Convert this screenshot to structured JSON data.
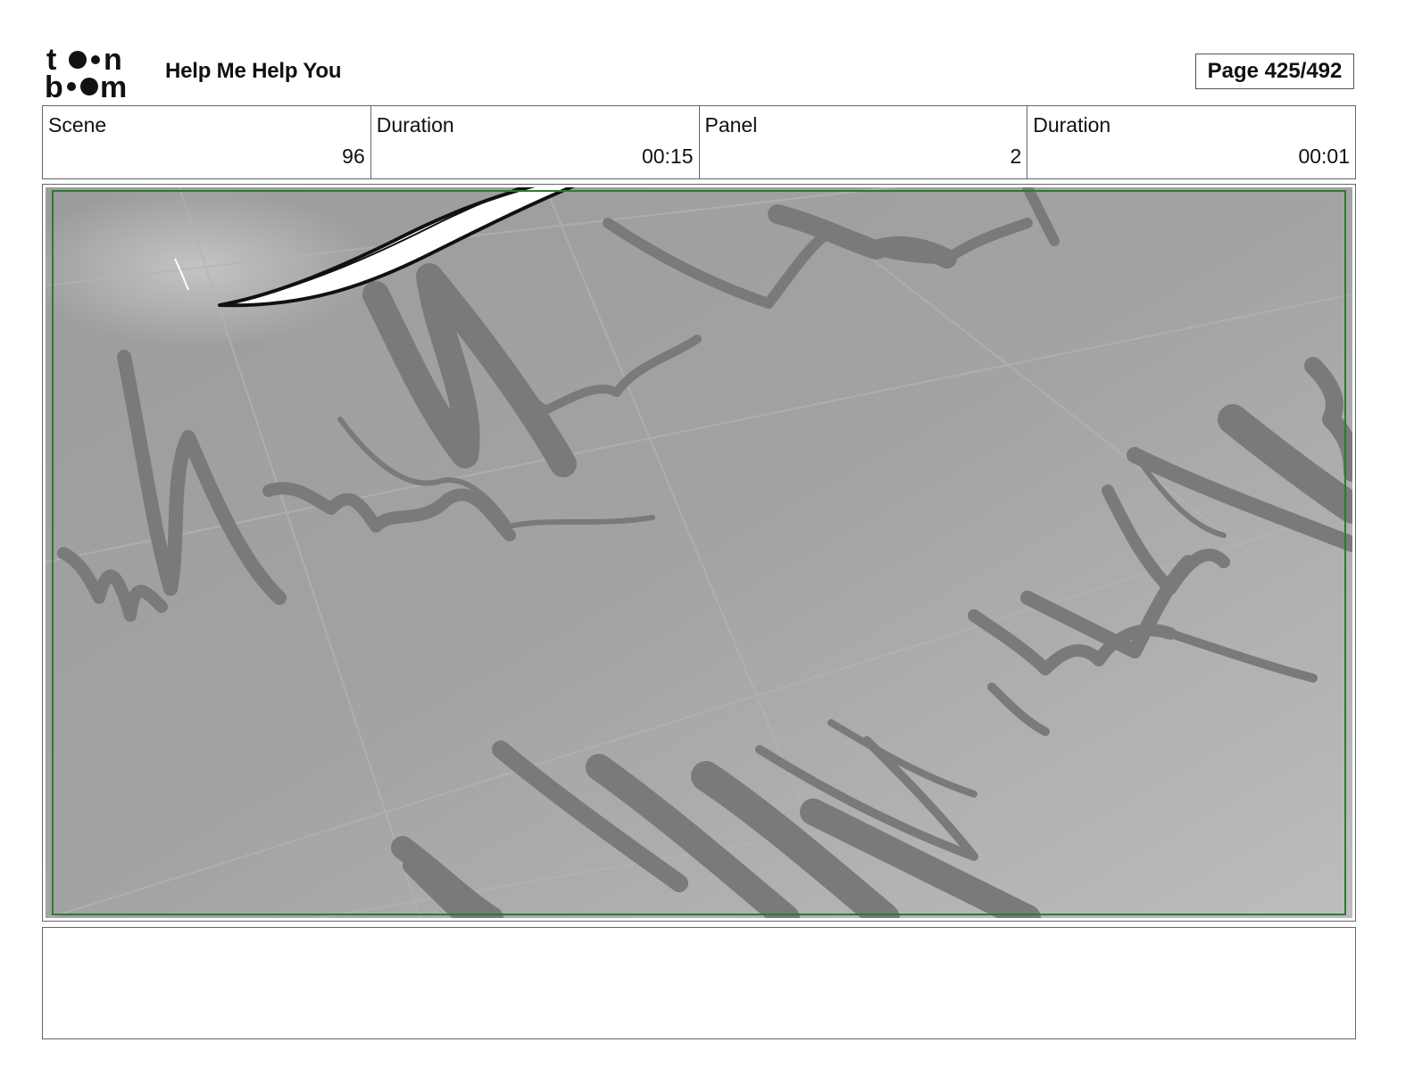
{
  "header": {
    "logo_text_top": "toon",
    "logo_text_bottom": "boom",
    "project_title": "Help Me Help You",
    "page_label": "Page 425/492"
  },
  "info": {
    "scene_label": "Scene",
    "scene_value": "96",
    "scene_duration_label": "Duration",
    "scene_duration_value": "00:15",
    "panel_label": "Panel",
    "panel_value": "2",
    "panel_duration_label": "Duration",
    "panel_duration_value": "00:01"
  },
  "panel": {
    "safe_frame_color": "#2f7a2f",
    "background_color": "#a6a6a6",
    "scribble_color": "#7a7a7a"
  },
  "notes": {
    "text": ""
  }
}
